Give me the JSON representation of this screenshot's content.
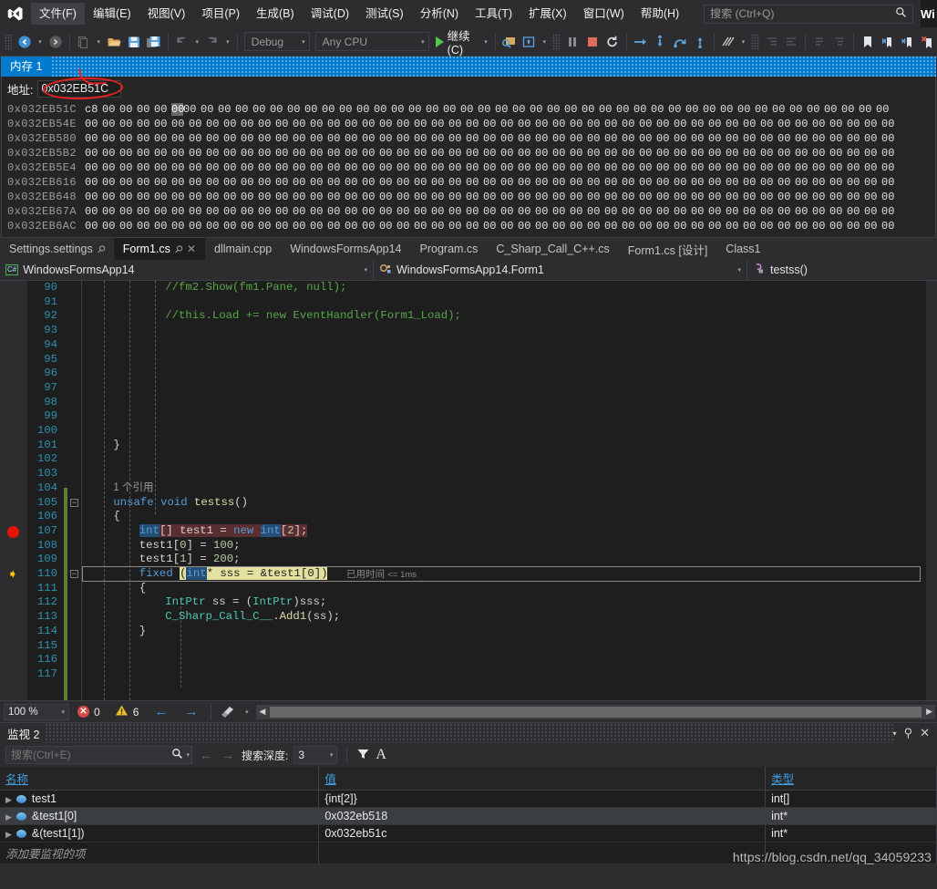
{
  "menu": {
    "logo_icon": "visual-studio-logo-icon",
    "items": [
      {
        "label": "文件(F)",
        "active": true
      },
      {
        "label": "编辑(E)",
        "active": false
      },
      {
        "label": "视图(V)",
        "active": false
      },
      {
        "label": "项目(P)",
        "active": false
      },
      {
        "label": "生成(B)",
        "active": false
      },
      {
        "label": "调试(D)",
        "active": false
      },
      {
        "label": "测试(S)",
        "active": false
      },
      {
        "label": "分析(N)",
        "active": false
      },
      {
        "label": "工具(T)",
        "active": false
      },
      {
        "label": "扩展(X)",
        "active": false
      },
      {
        "label": "窗口(W)",
        "active": false
      },
      {
        "label": "帮助(H)",
        "active": false
      }
    ],
    "search_placeholder": "搜索 (Ctrl+Q)",
    "search_value": "",
    "search_icon": "magnifier-icon",
    "window_tag": "Wi"
  },
  "toolbar": {
    "back_icon": "navigate-back-icon",
    "forward_icon": "navigate-forward-icon",
    "new_icon": "new-file-icon",
    "open_icon": "open-folder-icon",
    "save_icon": "save-icon",
    "saveall_icon": "save-all-icon",
    "undo_icon": "undo-icon",
    "redo_icon": "redo-icon",
    "config_value": "Debug",
    "platform_value": "Any CPU",
    "continue_label": "继续(C)",
    "continue_icon": "play-continue-icon",
    "attach_icon": "attach-process-icon",
    "hotreload_icon": "hot-reload-icon",
    "pause_icon": "pause-icon",
    "stop_icon": "stop-icon",
    "restart_icon": "restart-icon",
    "showstmt_icon": "show-next-statement-icon",
    "stepinto_icon": "step-into-icon",
    "stepover_icon": "step-over-icon",
    "stepout_icon": "step-out-icon",
    "threads_icon": "threads-icon",
    "indent1_icon": "indent-decrease-icon",
    "indent2_icon": "indent-increase-icon",
    "comment_icon": "comment-icon",
    "uncomment_icon": "uncomment-icon",
    "bookmark_icon": "bookmark-icon",
    "bookmark_prev_icon": "bookmark-previous-icon",
    "bookmark_next_icon": "bookmark-next-icon",
    "bookmark_clear_icon": "bookmark-clear-icon"
  },
  "memory": {
    "tab_label": "内存 1",
    "address_label": "地址:",
    "address_value": "0x032EB51C",
    "annotation_red": "red-ellipse-annotation",
    "annotation_blue": "blue-ellipse-annotation",
    "rows": [
      {
        "addr": "0x032EB51C",
        "first": "c8",
        "cursor_index": 4,
        "cells": [
          "00",
          "00",
          "00",
          "00",
          "00",
          "00",
          "00",
          "00",
          "00",
          "00",
          "00",
          "00",
          "00",
          "00",
          "00",
          "00",
          "00",
          "00",
          "00",
          "00",
          "00",
          "00",
          "00",
          "00",
          "00",
          "00",
          "00",
          "00",
          "00",
          "00",
          "00",
          "00",
          "00",
          "00",
          "00",
          "00",
          "00",
          "00",
          "00",
          "00",
          "00",
          "00",
          "00",
          "00",
          "00",
          "00"
        ]
      },
      {
        "addr": "0x032EB54E",
        "first": "00",
        "cursor_index": -1,
        "cells": [
          "00",
          "00",
          "00",
          "00",
          "00",
          "00",
          "00",
          "00",
          "00",
          "00",
          "00",
          "00",
          "00",
          "00",
          "00",
          "00",
          "00",
          "00",
          "00",
          "00",
          "00",
          "00",
          "00",
          "00",
          "00",
          "00",
          "00",
          "00",
          "00",
          "00",
          "00",
          "00",
          "00",
          "00",
          "00",
          "00",
          "00",
          "00",
          "00",
          "00",
          "00",
          "00",
          "00",
          "00",
          "00",
          "00"
        ]
      },
      {
        "addr": "0x032EB580",
        "first": "00",
        "cursor_index": -1,
        "cells": [
          "00",
          "00",
          "00",
          "00",
          "00",
          "00",
          "00",
          "00",
          "00",
          "00",
          "00",
          "00",
          "00",
          "00",
          "00",
          "00",
          "00",
          "00",
          "00",
          "00",
          "00",
          "00",
          "00",
          "00",
          "00",
          "00",
          "00",
          "00",
          "00",
          "00",
          "00",
          "00",
          "00",
          "00",
          "00",
          "00",
          "00",
          "00",
          "00",
          "00",
          "00",
          "00",
          "00",
          "00",
          "00",
          "00"
        ]
      },
      {
        "addr": "0x032EB5B2",
        "first": "00",
        "cursor_index": -1,
        "cells": [
          "00",
          "00",
          "00",
          "00",
          "00",
          "00",
          "00",
          "00",
          "00",
          "00",
          "00",
          "00",
          "00",
          "00",
          "00",
          "00",
          "00",
          "00",
          "00",
          "00",
          "00",
          "00",
          "00",
          "00",
          "00",
          "00",
          "00",
          "00",
          "00",
          "00",
          "00",
          "00",
          "00",
          "00",
          "00",
          "00",
          "00",
          "00",
          "00",
          "00",
          "00",
          "00",
          "00",
          "00",
          "00",
          "00"
        ]
      },
      {
        "addr": "0x032EB5E4",
        "first": "00",
        "cursor_index": -1,
        "cells": [
          "00",
          "00",
          "00",
          "00",
          "00",
          "00",
          "00",
          "00",
          "00",
          "00",
          "00",
          "00",
          "00",
          "00",
          "00",
          "00",
          "00",
          "00",
          "00",
          "00",
          "00",
          "00",
          "00",
          "00",
          "00",
          "00",
          "00",
          "00",
          "00",
          "00",
          "00",
          "00",
          "00",
          "00",
          "00",
          "00",
          "00",
          "00",
          "00",
          "00",
          "00",
          "00",
          "00",
          "00",
          "00",
          "00"
        ]
      },
      {
        "addr": "0x032EB616",
        "first": "00",
        "cursor_index": -1,
        "cells": [
          "00",
          "00",
          "00",
          "00",
          "00",
          "00",
          "00",
          "00",
          "00",
          "00",
          "00",
          "00",
          "00",
          "00",
          "00",
          "00",
          "00",
          "00",
          "00",
          "00",
          "00",
          "00",
          "00",
          "00",
          "00",
          "00",
          "00",
          "00",
          "00",
          "00",
          "00",
          "00",
          "00",
          "00",
          "00",
          "00",
          "00",
          "00",
          "00",
          "00",
          "00",
          "00",
          "00",
          "00",
          "00",
          "00"
        ]
      },
      {
        "addr": "0x032EB648",
        "first": "00",
        "cursor_index": -1,
        "cells": [
          "00",
          "00",
          "00",
          "00",
          "00",
          "00",
          "00",
          "00",
          "00",
          "00",
          "00",
          "00",
          "00",
          "00",
          "00",
          "00",
          "00",
          "00",
          "00",
          "00",
          "00",
          "00",
          "00",
          "00",
          "00",
          "00",
          "00",
          "00",
          "00",
          "00",
          "00",
          "00",
          "00",
          "00",
          "00",
          "00",
          "00",
          "00",
          "00",
          "00",
          "00",
          "00",
          "00",
          "00",
          "00",
          "00"
        ]
      },
      {
        "addr": "0x032EB67A",
        "first": "00",
        "cursor_index": -1,
        "cells": [
          "00",
          "00",
          "00",
          "00",
          "00",
          "00",
          "00",
          "00",
          "00",
          "00",
          "00",
          "00",
          "00",
          "00",
          "00",
          "00",
          "00",
          "00",
          "00",
          "00",
          "00",
          "00",
          "00",
          "00",
          "00",
          "00",
          "00",
          "00",
          "00",
          "00",
          "00",
          "00",
          "00",
          "00",
          "00",
          "00",
          "00",
          "00",
          "00",
          "00",
          "00",
          "00",
          "00",
          "00",
          "00",
          "00"
        ]
      },
      {
        "addr": "0x032EB6AC",
        "first": "00",
        "cursor_index": -1,
        "cells": [
          "00",
          "00",
          "00",
          "00",
          "00",
          "00",
          "00",
          "00",
          "00",
          "00",
          "00",
          "00",
          "00",
          "00",
          "00",
          "00",
          "00",
          "00",
          "00",
          "00",
          "00",
          "00",
          "00",
          "00",
          "00",
          "00",
          "00",
          "00",
          "00",
          "00",
          "00",
          "00",
          "00",
          "00",
          "00",
          "00",
          "00",
          "00",
          "00",
          "00",
          "00",
          "00",
          "00",
          "00",
          "00",
          "00"
        ]
      }
    ]
  },
  "doc_tabs": [
    {
      "label": "Settings.settings",
      "active": false,
      "pin": true,
      "close": false
    },
    {
      "label": "Form1.cs",
      "active": true,
      "pin": true,
      "close": true
    },
    {
      "label": "dllmain.cpp",
      "active": false,
      "pin": false,
      "close": false
    },
    {
      "label": "WindowsFormsApp14",
      "active": false,
      "pin": false,
      "close": false
    },
    {
      "label": "Program.cs",
      "active": false,
      "pin": false,
      "close": false
    },
    {
      "label": "C_Sharp_Call_C++.cs",
      "active": false,
      "pin": false,
      "close": false
    },
    {
      "label": "Form1.cs [设计]",
      "active": false,
      "pin": false,
      "close": false
    },
    {
      "label": "Class1",
      "active": false,
      "pin": false,
      "close": false
    }
  ],
  "navbar": {
    "project_icon": "csharp-file-icon",
    "project": "WindowsFormsApp14",
    "class_icon": "class-icon",
    "class": "WindowsFormsApp14.Form1",
    "member_icon": "method-private-icon",
    "member": "testss()"
  },
  "code": {
    "elapsed_label": "已用时间",
    "elapsed_value": "<= 1ms",
    "reference_label": "1 个引用",
    "lines": [
      {
        "n": "90",
        "text": "//fm2.Show(fm1.Pane, null);"
      },
      {
        "n": "91",
        "text": ""
      },
      {
        "n": "92",
        "text": "//this.Load += new EventHandler(Form1_Load);"
      },
      {
        "n": "93",
        "text": ""
      },
      {
        "n": "94",
        "text": ""
      },
      {
        "n": "95",
        "text": ""
      },
      {
        "n": "96",
        "text": ""
      },
      {
        "n": "97",
        "text": ""
      },
      {
        "n": "98",
        "text": ""
      },
      {
        "n": "99",
        "text": ""
      },
      {
        "n": "100",
        "text": ""
      },
      {
        "n": "101",
        "text": "}"
      },
      {
        "n": "102",
        "text": ""
      },
      {
        "n": "103",
        "text": ""
      },
      {
        "n": "104",
        "text": ""
      },
      {
        "n": "105",
        "text": "unsafe void testss()"
      },
      {
        "n": "106",
        "text": "{"
      },
      {
        "n": "107",
        "text": "int[] test1 = new int[2];"
      },
      {
        "n": "108",
        "text": "test1[0] = 100;"
      },
      {
        "n": "109",
        "text": "test1[1] = 200;"
      },
      {
        "n": "110",
        "text": "fixed (int* sss = &test1[0])"
      },
      {
        "n": "111",
        "text": "{"
      },
      {
        "n": "112",
        "text": "IntPtr ss = (IntPtr)sss;"
      },
      {
        "n": "113",
        "text": "C_Sharp_Call_C__.Add1(ss);"
      },
      {
        "n": "114",
        "text": "}"
      },
      {
        "n": "115",
        "text": ""
      },
      {
        "n": "116",
        "text": ""
      },
      {
        "n": "117",
        "text": ""
      }
    ],
    "breakpoint_line": "107",
    "current_line": "110"
  },
  "editor_status": {
    "zoom": "100 %",
    "error_count": "0",
    "warning_count": "6",
    "error_icon": "error-circle-icon",
    "warning_icon": "warning-triangle-icon",
    "prev_icon": "navigate-backward-icon",
    "next_icon": "navigate-forward-icon",
    "broom_icon": "code-cleanup-icon"
  },
  "watch": {
    "title": "监视 2",
    "dropdown_icon": "chevron-down-icon",
    "pin_icon": "pin-icon",
    "close_icon": "close-icon",
    "search_placeholder": "搜索(Ctrl+E)",
    "search_value": "",
    "search_icon": "magnifier-icon",
    "prev_icon": "arrow-left-icon",
    "next_icon": "arrow-right-icon",
    "depth_label": "搜索深度:",
    "depth_value": "3",
    "filter_icon": "filter-funnel-icon",
    "font_icon": "text-format-icon",
    "columns": [
      "名称",
      "值",
      "类型"
    ],
    "rows": [
      {
        "name": "test1",
        "value": "{int[2]}",
        "type": "int[]",
        "selected": false,
        "expandable": true
      },
      {
        "name": "&test1[0]",
        "value": "0x032eb518",
        "type": "int*",
        "selected": true,
        "expandable": true
      },
      {
        "name": "&(test1[1])",
        "value": "0x032eb51c",
        "type": "int*",
        "selected": false,
        "expandable": true
      }
    ],
    "add_row_placeholder": "添加要监视的项"
  },
  "watermark": "https://blog.csdn.net/qq_34059233",
  "colors": {
    "accent": "#007acc",
    "editor_bg": "#1e1e1e",
    "chrome_bg": "#2d2d30",
    "breakpoint": "#e51400",
    "annotation_red": "#e8221f",
    "annotation_blue": "#1520d8"
  }
}
